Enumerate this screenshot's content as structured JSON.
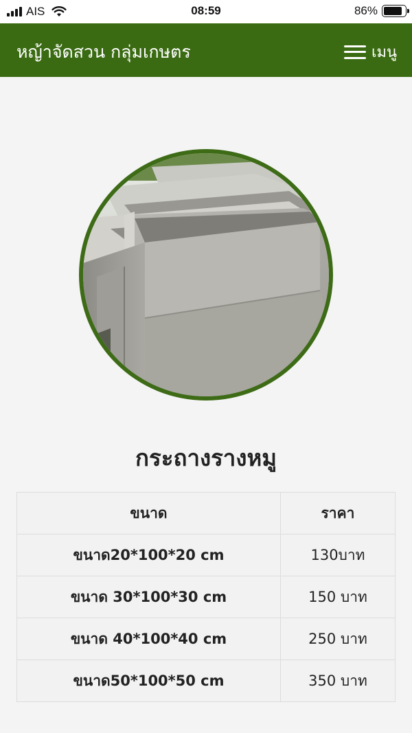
{
  "status_bar": {
    "carrier": "AIS",
    "time": "08:59",
    "battery": "86%",
    "battery_level": 0.86
  },
  "navbar": {
    "brand": "หญ้าจัดสวน กลุ่มเกษตร",
    "menu_label": "เมนู",
    "background": "#3a6b12"
  },
  "product": {
    "image_alt": "concrete planter boxes",
    "title": "กระถางรางหมู"
  },
  "table": {
    "headers": [
      "ขนาด",
      "ราคา"
    ],
    "rows": [
      {
        "size": "ขนาด20*100*20 cm",
        "price": "130บาท"
      },
      {
        "size": "ขนาด 30*100*30 cm",
        "price": "150 บาท"
      },
      {
        "size": "ขนาด 40*100*40 cm",
        "price": "250 บาท"
      },
      {
        "size": "ขนาด50*100*50 cm",
        "price": "350 บาท"
      }
    ]
  }
}
